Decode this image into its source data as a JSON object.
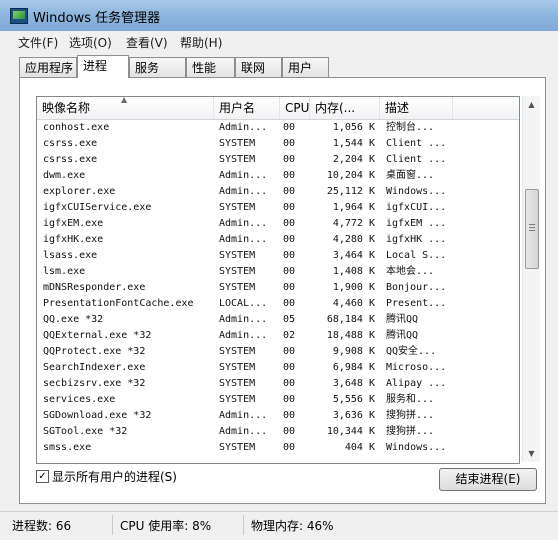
{
  "window": {
    "title": "Windows 任务管理器"
  },
  "menu": [
    "文件(F)",
    "选项(O)",
    "查看(V)",
    "帮助(H)"
  ],
  "tabs": [
    "应用程序",
    "进程",
    "服务",
    "性能",
    "联网",
    "用户"
  ],
  "active_tab": "进程",
  "columns": {
    "name": "映像名称",
    "user": "用户名",
    "cpu": "CPU",
    "mem": "内存(...",
    "desc": "描述"
  },
  "processes": [
    {
      "name": "conhost.exe",
      "user": "Admin...",
      "cpu": "00",
      "mem": "1,056 K",
      "desc": "控制台..."
    },
    {
      "name": "csrss.exe",
      "user": "SYSTEM",
      "cpu": "00",
      "mem": "1,544 K",
      "desc": "Client ..."
    },
    {
      "name": "csrss.exe",
      "user": "SYSTEM",
      "cpu": "00",
      "mem": "2,204 K",
      "desc": "Client ..."
    },
    {
      "name": "dwm.exe",
      "user": "Admin...",
      "cpu": "00",
      "mem": "10,204 K",
      "desc": "桌面窗..."
    },
    {
      "name": "explorer.exe",
      "user": "Admin...",
      "cpu": "00",
      "mem": "25,112 K",
      "desc": "Windows..."
    },
    {
      "name": "igfxCUIService.exe",
      "user": "SYSTEM",
      "cpu": "00",
      "mem": "1,964 K",
      "desc": "igfxCUI..."
    },
    {
      "name": "igfxEM.exe",
      "user": "Admin...",
      "cpu": "00",
      "mem": "4,772 K",
      "desc": "igfxEM ..."
    },
    {
      "name": "igfxHK.exe",
      "user": "Admin...",
      "cpu": "00",
      "mem": "4,280 K",
      "desc": "igfxHK ..."
    },
    {
      "name": "lsass.exe",
      "user": "SYSTEM",
      "cpu": "00",
      "mem": "3,464 K",
      "desc": "Local S..."
    },
    {
      "name": "lsm.exe",
      "user": "SYSTEM",
      "cpu": "00",
      "mem": "1,408 K",
      "desc": "本地会..."
    },
    {
      "name": "mDNSResponder.exe",
      "user": "SYSTEM",
      "cpu": "00",
      "mem": "1,900 K",
      "desc": "Bonjour..."
    },
    {
      "name": "PresentationFontCache.exe",
      "user": "LOCAL...",
      "cpu": "00",
      "mem": "4,460 K",
      "desc": "Present..."
    },
    {
      "name": "QQ.exe *32",
      "user": "Admin...",
      "cpu": "05",
      "mem": "68,184 K",
      "desc": "腾讯QQ"
    },
    {
      "name": "QQExternal.exe *32",
      "user": "Admin...",
      "cpu": "02",
      "mem": "18,488 K",
      "desc": "腾讯QQ"
    },
    {
      "name": "QQProtect.exe *32",
      "user": "SYSTEM",
      "cpu": "00",
      "mem": "9,908 K",
      "desc": "QQ安全..."
    },
    {
      "name": "SearchIndexer.exe",
      "user": "SYSTEM",
      "cpu": "00",
      "mem": "6,984 K",
      "desc": "Microso..."
    },
    {
      "name": "secbizsrv.exe *32",
      "user": "SYSTEM",
      "cpu": "00",
      "mem": "3,648 K",
      "desc": "Alipay ..."
    },
    {
      "name": "services.exe",
      "user": "SYSTEM",
      "cpu": "00",
      "mem": "5,556 K",
      "desc": "服务和..."
    },
    {
      "name": "SGDownload.exe *32",
      "user": "Admin...",
      "cpu": "00",
      "mem": "3,636 K",
      "desc": "搜狗拼..."
    },
    {
      "name": "SGTool.exe *32",
      "user": "Admin...",
      "cpu": "00",
      "mem": "10,344 K",
      "desc": "搜狗拼..."
    },
    {
      "name": "smss.exe",
      "user": "SYSTEM",
      "cpu": "00",
      "mem": "404 K",
      "desc": "Windows..."
    }
  ],
  "show_all_users": {
    "label": "显示所有用户的进程(S)",
    "checked": true
  },
  "end_process_label": "结束进程(E)",
  "status": {
    "processes": "进程数: 66",
    "cpu": "CPU 使用率: 8%",
    "memory": "物理内存: 46%"
  }
}
